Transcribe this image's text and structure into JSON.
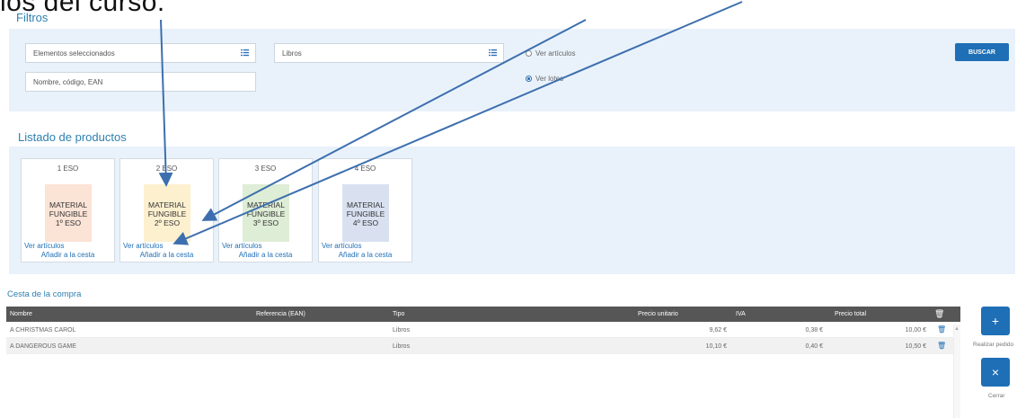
{
  "overlay": {
    "text": "los del curso."
  },
  "filters": {
    "title": "Filtros",
    "selected_elements": "Elementos seleccionados",
    "category": "Libros",
    "search_placeholder": "Nombre, código, EAN",
    "radio_articles": "Ver artículos",
    "radio_lots": "Ver lotes",
    "selected_radio": "lots",
    "search_button": "BUSCAR"
  },
  "products": {
    "title": "Listado de productos",
    "cards": [
      {
        "course": "1 ESO",
        "line1": "MATERIAL",
        "line2": "FUNGIBLE",
        "line3": "1º ESO",
        "color": "#fbe3d6",
        "view": "Ver artículos",
        "add": "Añadir a la cesta"
      },
      {
        "course": "2 ESO",
        "line1": "MATERIAL",
        "line2": "FUNGIBLE",
        "line3": "2º ESO",
        "color": "#fdf0cf",
        "view": "Ver artículos",
        "add": "Añadir a la cesta"
      },
      {
        "course": "3 ESO",
        "line1": "MATERIAL",
        "line2": "FUNGIBLE",
        "line3": "3º ESO",
        "color": "#deedd6",
        "view": "Ver artículos",
        "add": "Añadir a la cesta"
      },
      {
        "course": "4 ESO",
        "line1": "MATERIAL",
        "line2": "FUNGIBLE",
        "line3": "4º ESO",
        "color": "#d9e1f1",
        "view": "Ver artículos",
        "add": "Añadir a la cesta"
      }
    ]
  },
  "cart": {
    "title": "Cesta de la compra",
    "headers": {
      "name": "Nombre",
      "ref": "Referencia (EAN)",
      "type": "Tipo",
      "unit_price": "Precio unitario",
      "vat": "IVA",
      "total": "Precio total"
    },
    "rows": [
      {
        "name": "A CHRISTMAS CAROL",
        "ref": "",
        "type": "Libros",
        "unit_price": "9,62 €",
        "vat": "0,38 €",
        "total": "10,00 €"
      },
      {
        "name": "A DANGEROUS GAME",
        "ref": "",
        "type": "Libros",
        "unit_price": "10,10 €",
        "vat": "0,40 €",
        "total": "10,50 €"
      }
    ]
  },
  "actions": {
    "order_icon": "plus-icon",
    "order_label": "Realizar pedido",
    "close_icon": "close-icon",
    "close_label": "Cerrar"
  },
  "colors": {
    "accent": "#1f6fb6",
    "panel": "#e9f2fb",
    "header": "#565656",
    "title": "#2e7fb0"
  }
}
